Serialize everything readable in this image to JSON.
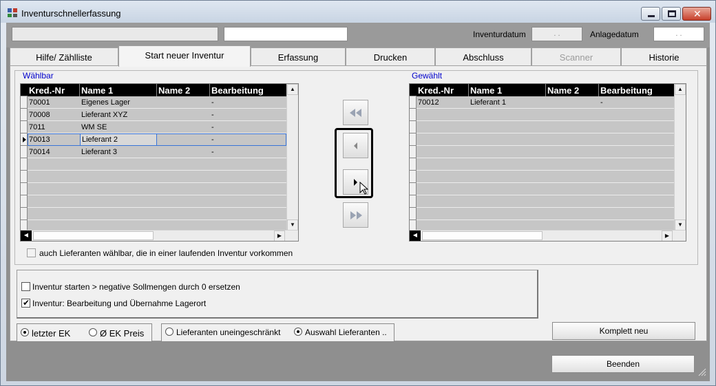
{
  "window": {
    "title": "Inventurschnellerfassung"
  },
  "header": {
    "field1_value": "",
    "field2_value": "",
    "inventurdatum_label": "Inventurdatum",
    "inventurdatum_value": ". .",
    "anlagedatum_label": "Anlagedatum",
    "anlagedatum_value": ". ."
  },
  "tabs": [
    {
      "label": "Hilfe/ Zählliste"
    },
    {
      "label": "Start neuer Inventur"
    },
    {
      "label": "Erfassung"
    },
    {
      "label": "Drucken"
    },
    {
      "label": "Abschluss"
    },
    {
      "label": "Scanner"
    },
    {
      "label": "Historie"
    }
  ],
  "active_tab": "Start neuer Inventur",
  "waehlbar": {
    "label": "Wählbar",
    "columns": [
      "Kred.-Nr",
      "Name 1",
      "Name 2",
      "Bearbeitung"
    ],
    "rows": [
      {
        "nr": "70001",
        "name1": "Eigenes Lager",
        "name2": "",
        "bearbeitung": "-"
      },
      {
        "nr": "70008",
        "name1": "Lieferant XYZ",
        "name2": "",
        "bearbeitung": "-"
      },
      {
        "nr": "7011",
        "name1": "WM SE",
        "name2": "",
        "bearbeitung": "-"
      },
      {
        "nr": "70013",
        "name1": "Lieferant 2",
        "name2": "",
        "bearbeitung": "-"
      },
      {
        "nr": "70014",
        "name1": "Lieferant 3",
        "name2": "",
        "bearbeitung": "-"
      }
    ]
  },
  "gewaehlt": {
    "label": "Gewählt",
    "columns": [
      "Kred.-Nr",
      "Name 1",
      "Name 2",
      "Bearbeitung"
    ],
    "rows": [
      {
        "nr": "70012",
        "name1": "Lieferant 1",
        "name2": "",
        "bearbeitung": "-"
      }
    ]
  },
  "nav_buttons": {
    "all_left": "double-left-arrow-icon",
    "left": "left-arrow-icon",
    "right": "right-arrow-icon",
    "all_right": "double-right-arrow-icon"
  },
  "options": {
    "laufende_inventur_label": "auch Lieferanten wählbar, die in einer laufenden Inventur vorkommen",
    "laufende_inventur_checked": false,
    "negative_sollmengen_label": "Inventur starten > negative Sollmengen durch 0 ersetzen",
    "negative_sollmengen_checked": false,
    "lagerort_label": "Inventur: Bearbeitung und Übernahme Lagerort",
    "lagerort_checked": true
  },
  "price_radio": {
    "letzter_ek": "letzter EK",
    "ek_preis": "Ø EK Preis",
    "selected": "letzter EK"
  },
  "lieferanten_radio": {
    "uneingeschraenkt": "Lieferanten uneingeschränkt",
    "auswahl": "Auswahl Lieferanten ..",
    "selected": "Auswahl Lieferanten .."
  },
  "buttons": {
    "komplett_neu": "Komplett neu",
    "beenden": "Beenden"
  }
}
